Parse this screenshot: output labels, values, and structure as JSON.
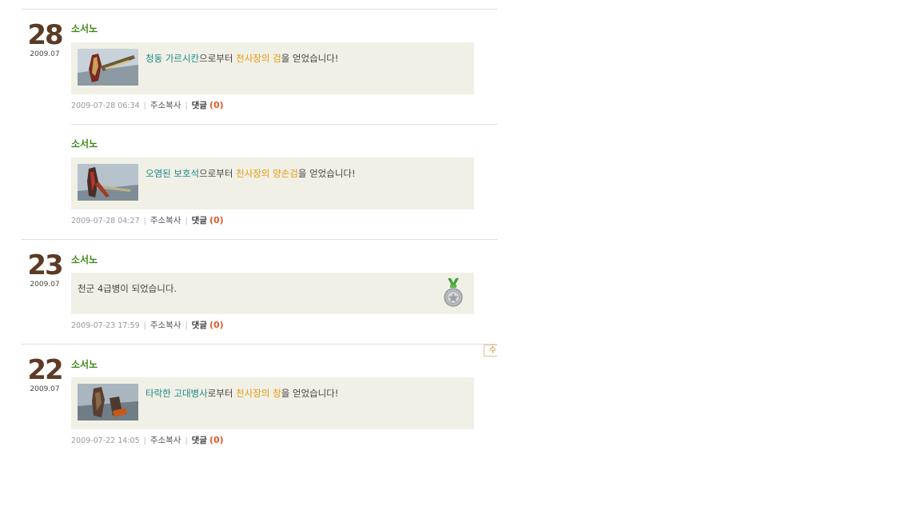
{
  "entries": [
    {
      "day": "28",
      "ym": "2009.07",
      "posts": [
        {
          "author": "소서노",
          "source": "청동 가르시칸",
          "mid": "으로부터 ",
          "item": "천사장의 검",
          "tail": "을 얻었습니다!",
          "time": "2009-07-28 06:34",
          "copy": "주소복사",
          "comment": "댓글",
          "count": "(0)"
        },
        {
          "author": "소서노",
          "source": "오염된 보호석",
          "mid": "으로부터 ",
          "item": "천사장의 양손검",
          "tail": "을 얻었습니다!",
          "time": "2009-07-28 04:27",
          "copy": "주소복사",
          "comment": "댓글",
          "count": "(0)"
        }
      ]
    },
    {
      "day": "23",
      "ym": "2009.07",
      "posts": [
        {
          "author": "소서노",
          "text": "천군 4급병이 되었습니다.",
          "time": "2009-07-23 17:59",
          "copy": "주소복사",
          "comment": "댓글",
          "count": "(0)"
        }
      ]
    },
    {
      "day": "22",
      "ym": "2009.07",
      "posts": [
        {
          "author": "소서노",
          "source": "타락한 고대병사",
          "mid": "로부터 ",
          "item": "천사장의 창",
          "tail": "을 얻었습니다!",
          "time": "2009-07-22 14:05",
          "copy": "주소복사",
          "comment": "댓글",
          "count": "(0)"
        }
      ]
    }
  ],
  "edge_tab": "수",
  "colors": {
    "author": "#3f8a1c",
    "source": "#1a8a88",
    "item": "#e59a10",
    "count": "#e05a2c",
    "box": "#f1f0e6",
    "day": "#5c3b24"
  }
}
